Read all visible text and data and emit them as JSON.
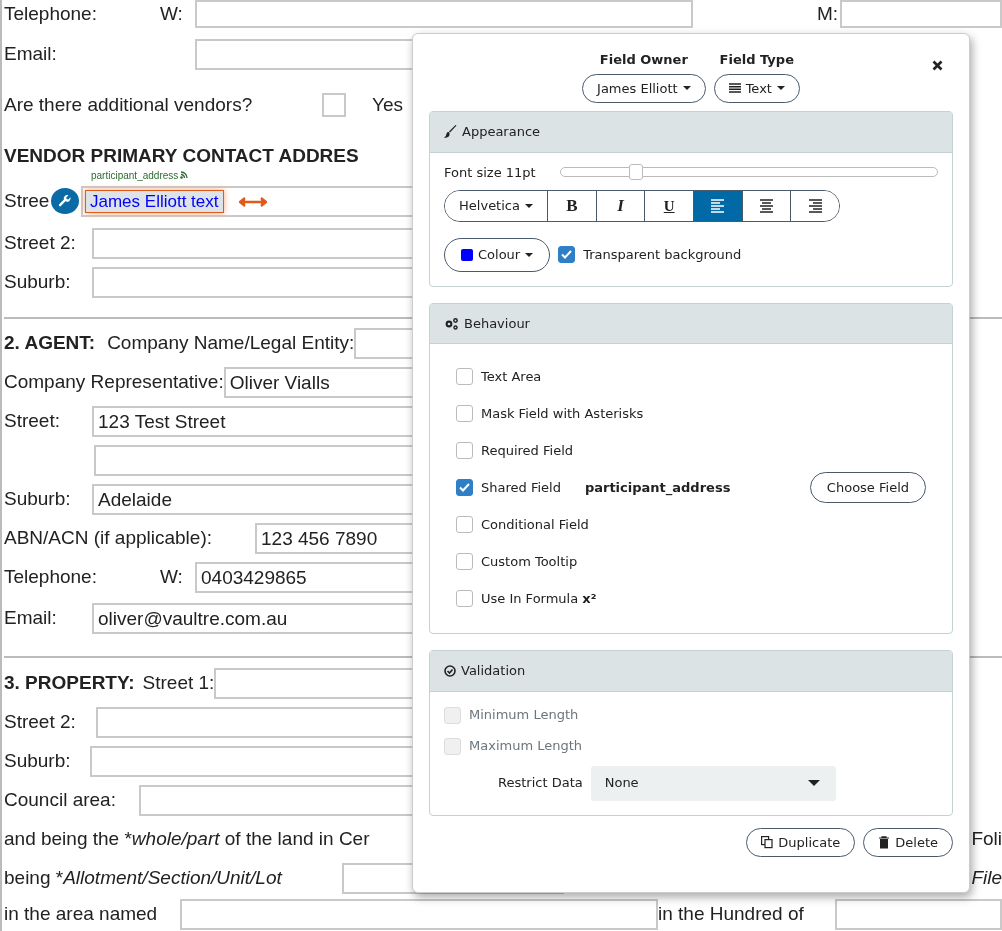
{
  "document": {
    "rows": [
      {
        "items": [
          {
            "kind": "label",
            "text": "Telephone:"
          },
          {
            "kind": "label",
            "text": "W:"
          },
          {
            "kind": "field",
            "value": ""
          },
          {
            "kind": "label",
            "text": "M:"
          },
          {
            "kind": "field",
            "value": ""
          }
        ]
      },
      {
        "items": [
          {
            "kind": "label",
            "text": "Email:"
          },
          {
            "kind": "field",
            "value": ""
          }
        ]
      },
      {
        "items": [
          {
            "kind": "label",
            "text": "Are there additional vendors?"
          },
          {
            "kind": "checkbox",
            "checked": false
          },
          {
            "kind": "label",
            "text": "Yes"
          }
        ]
      },
      {
        "items": [
          {
            "kind": "heading",
            "text": "VENDOR PRIMARY CONTACT ADDRES"
          }
        ]
      },
      {
        "items": [
          {
            "kind": "label",
            "text": "Stree"
          },
          {
            "kind": "tool"
          },
          {
            "kind": "editor",
            "value": "James Elliott text",
            "tag": "participant_address"
          }
        ]
      },
      {
        "items": [
          {
            "kind": "label",
            "text": "Street 2:"
          },
          {
            "kind": "field",
            "value": ""
          }
        ]
      },
      {
        "items": [
          {
            "kind": "label",
            "text": "Suburb:"
          },
          {
            "kind": "field",
            "value": ""
          }
        ]
      },
      {
        "items": [
          {
            "kind": "divider"
          }
        ]
      },
      {
        "items": [
          {
            "kind": "heading",
            "text": "2. AGENT:"
          },
          {
            "kind": "label",
            "text": "Company Name/Legal Entity:"
          },
          {
            "kind": "field",
            "value": ""
          }
        ]
      },
      {
        "items": [
          {
            "kind": "label",
            "text": "Company Representative:"
          },
          {
            "kind": "field",
            "value": "Oliver Vialls"
          }
        ]
      },
      {
        "items": [
          {
            "kind": "label",
            "text": "Street:"
          },
          {
            "kind": "field",
            "value": "123 Test Street"
          }
        ]
      },
      {
        "items": [
          {
            "kind": "field",
            "value": ""
          }
        ]
      },
      {
        "items": [
          {
            "kind": "label",
            "text": "Suburb:"
          },
          {
            "kind": "field",
            "value": "Adelaide"
          }
        ]
      },
      {
        "items": [
          {
            "kind": "label",
            "text": "ABN/ACN (if applicable):"
          },
          {
            "kind": "field",
            "value": "123 456 7890"
          }
        ]
      },
      {
        "items": [
          {
            "kind": "label",
            "text": "Telephone:"
          },
          {
            "kind": "label",
            "text": "W:"
          },
          {
            "kind": "field",
            "value": "0403429865"
          }
        ]
      },
      {
        "items": [
          {
            "kind": "label",
            "text": "Email:"
          },
          {
            "kind": "field",
            "value": "oliver@vaultre.com.au"
          }
        ]
      },
      {
        "items": [
          {
            "kind": "divider"
          }
        ]
      },
      {
        "items": [
          {
            "kind": "heading",
            "text": "3. PROPERTY:"
          },
          {
            "kind": "label",
            "text": "Street 1:"
          },
          {
            "kind": "field",
            "value": ""
          }
        ]
      },
      {
        "items": [
          {
            "kind": "label",
            "text": "Street 2:"
          },
          {
            "kind": "field",
            "value": ""
          }
        ]
      },
      {
        "items": [
          {
            "kind": "label",
            "text": "Suburb:"
          },
          {
            "kind": "field",
            "value": ""
          }
        ]
      },
      {
        "items": [
          {
            "kind": "label",
            "text": "Council area:"
          },
          {
            "kind": "field",
            "value": ""
          }
        ]
      },
      {
        "items": [
          {
            "kind": "label",
            "parts": [
              {
                "text": "and being the *",
                "italic": false
              },
              {
                "text": "whole/part",
                "italic": true
              },
              {
                "text": " of the land in Cer",
                "italic": false
              }
            ]
          },
          {
            "kind": "label",
            "text": "Foli"
          }
        ]
      },
      {
        "items": [
          {
            "kind": "label",
            "parts": [
              {
                "text": "being *",
                "italic": false
              },
              {
                "text": "Allotment/Section/Unit/Lot",
                "italic": true
              }
            ]
          },
          {
            "kind": "field",
            "value": ""
          },
          {
            "kind": "label",
            "text": "File",
            "italic": true
          }
        ]
      },
      {
        "items": [
          {
            "kind": "label",
            "text": "in the area named"
          },
          {
            "kind": "field",
            "value": ""
          },
          {
            "kind": "label",
            "text": "in the Hundred of"
          },
          {
            "kind": "field",
            "value": ""
          }
        ]
      }
    ]
  },
  "popup": {
    "owner_label": "Field Owner",
    "type_label": "Field Type",
    "owner": "James Elliott",
    "type": "Text",
    "appearance": {
      "title": "Appearance",
      "font_size": {
        "label": "Font size 11pt",
        "level": 0.2
      },
      "format": [
        {
          "kind": "font",
          "label": "Helvetica",
          "selected": false
        },
        {
          "kind": "bold",
          "label": "B",
          "selected": false
        },
        {
          "kind": "italic",
          "label": "I",
          "selected": false
        },
        {
          "kind": "underline",
          "label": "U",
          "selected": false
        },
        {
          "kind": "align-left",
          "selected": true
        },
        {
          "kind": "align-center",
          "selected": false
        },
        {
          "kind": "align-right",
          "selected": false
        }
      ],
      "colour": {
        "label": "Colour",
        "color": "#0000ff"
      },
      "transparent": {
        "label": "Transparent background",
        "checked": true
      }
    },
    "behaviour": {
      "title": "Behaviour",
      "options": [
        {
          "label": "Text Area",
          "checked": false
        },
        {
          "label": "Mask Field with Asterisks",
          "checked": false
        },
        {
          "label": "Required Field",
          "checked": false
        },
        {
          "label": "Shared Field",
          "checked": true,
          "value": "participant_address",
          "action": "Choose Field"
        },
        {
          "label": "Conditional Field",
          "checked": false
        },
        {
          "label": "Custom Tooltip",
          "checked": false
        },
        {
          "label": "Use In Formula **x²**",
          "checked": false
        }
      ]
    },
    "validation": {
      "title": "Validation",
      "options": [
        {
          "label": "Minimum Length",
          "checked": false,
          "disabled": true
        },
        {
          "label": "Maximum Length",
          "checked": false,
          "disabled": true
        }
      ],
      "restrict_label": "Restrict Data",
      "restrict_value": "None"
    },
    "buttons": [
      {
        "kind": "duplicate",
        "label": "Duplicate"
      },
      {
        "kind": "delete",
        "label": "Delete"
      }
    ]
  }
}
